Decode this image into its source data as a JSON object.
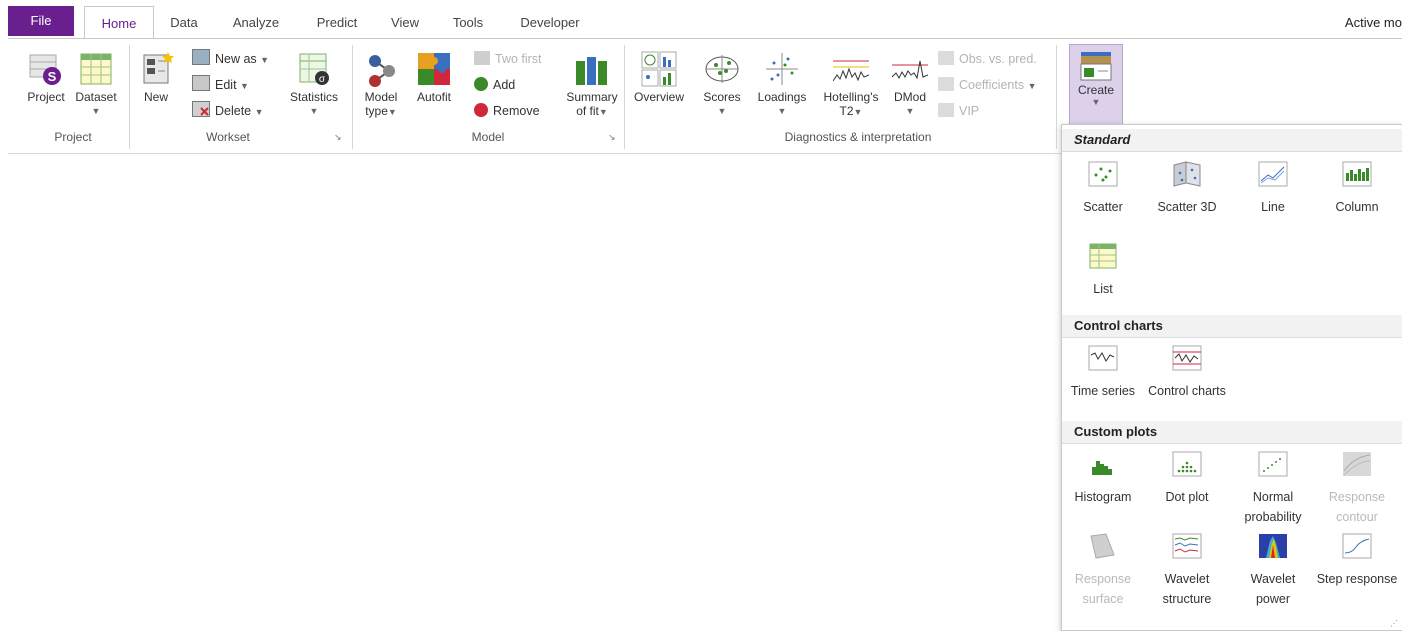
{
  "tabs": {
    "file": "File",
    "items": [
      "Home",
      "Data",
      "Analyze",
      "Predict",
      "View",
      "Tools",
      "Developer"
    ],
    "active": "Home",
    "active_model": "Active mo"
  },
  "ribbon": {
    "project_group": {
      "label": "Project",
      "project": "Project",
      "dataset": "Dataset"
    },
    "workset_group": {
      "label": "Workset",
      "new": "New",
      "new_as": "New as",
      "edit": "Edit",
      "delete": "Delete",
      "statistics": "Statistics"
    },
    "model_group": {
      "label": "Model",
      "model_type_1": "Model",
      "model_type_2": "type",
      "autofit": "Autofit",
      "two_first": "Two first",
      "add": "Add",
      "remove": "Remove",
      "summary_1": "Summary",
      "summary_2": "of fit"
    },
    "diag_group": {
      "label": "Diagnostics & interpretation",
      "overview": "Overview",
      "scores": "Scores",
      "loadings": "Loadings",
      "hotelling_1": "Hotelling's",
      "hotelling_2": "T2",
      "dmod": "DMod",
      "obs_pred": "Obs. vs. pred.",
      "coefficients": "Coefficients",
      "vip": "VIP"
    },
    "create": "Create"
  },
  "dropdown": {
    "standard": {
      "title": "Standard",
      "items": [
        "Scatter",
        "Scatter 3D",
        "Line",
        "Column",
        "List"
      ]
    },
    "control": {
      "title": "Control charts",
      "items": [
        "Time series",
        "Control charts"
      ]
    },
    "custom": {
      "title": "Custom plots",
      "items": [
        "Histogram",
        "Dot plot",
        "Normal probability",
        "Response contour",
        "Response surface",
        "Wavelet structure",
        "Wavelet power",
        "Step response"
      ]
    }
  },
  "colors": {
    "accent": "#6a1f8f",
    "create_highlight": "#dcd0ea",
    "green": "#3a8a2a",
    "red": "#d0283a"
  }
}
